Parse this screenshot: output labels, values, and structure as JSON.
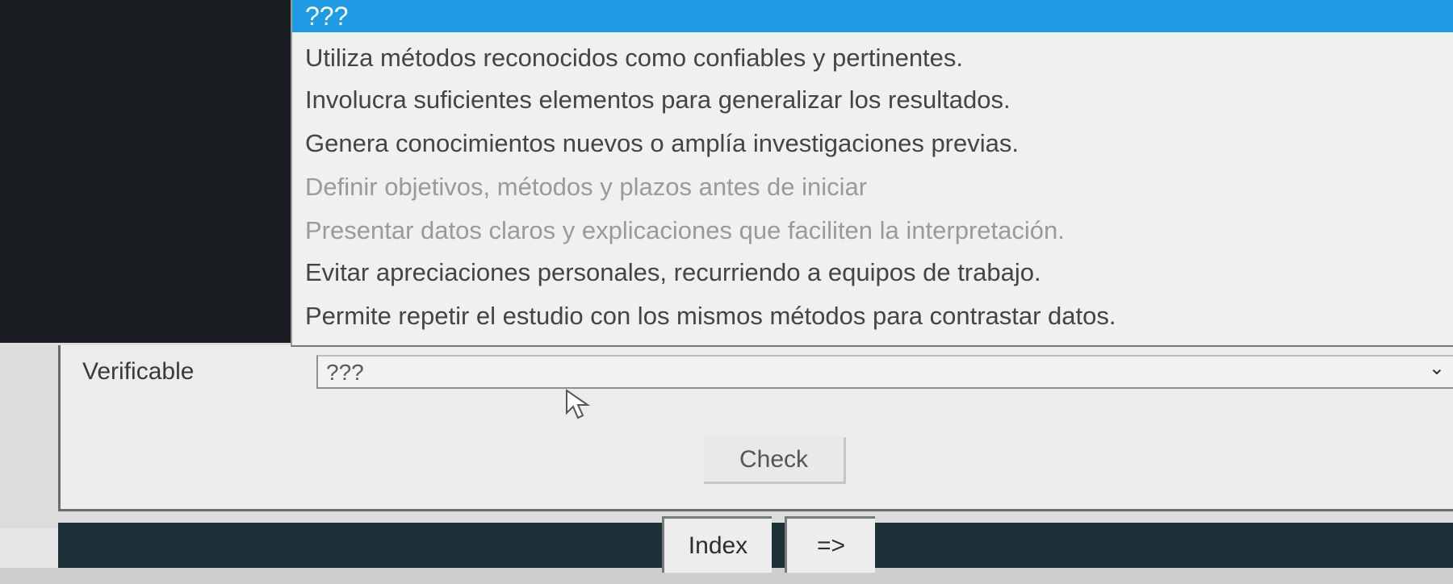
{
  "dropdown": {
    "header": "???",
    "options": [
      {
        "label": "Utiliza métodos reconocidos como confiables y pertinentes."
      },
      {
        "label": "Involucra suficientes elementos para generalizar los resultados."
      },
      {
        "label": "Genera conocimientos nuevos o amplía investigaciones previas."
      },
      {
        "label": "Definir objetivos, métodos y plazos antes de iniciar"
      },
      {
        "label": "Presentar datos claros y explicaciones que faciliten la interpretación."
      },
      {
        "label": "Evitar apreciaciones personales, recurriendo a equipos de trabajo."
      },
      {
        "label": "Permite repetir el estudio con los mismos métodos para contrastar datos."
      }
    ]
  },
  "quiz": {
    "term": "Verificable",
    "selected": "???",
    "chevron_icon": "chevron-down-icon"
  },
  "actions": {
    "check_label": "Check",
    "index_label": "Index",
    "next_label": "=>"
  },
  "colors": {
    "header": "#1e9be4",
    "footer": "#1b3137"
  }
}
